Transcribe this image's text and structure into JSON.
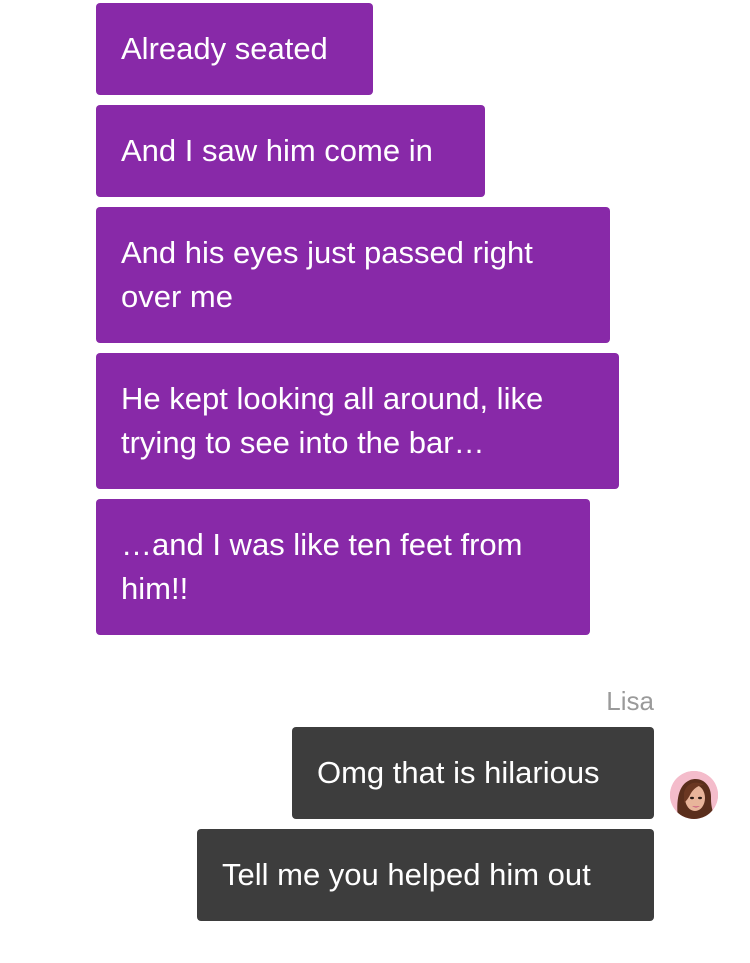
{
  "incoming_messages": [
    {
      "text": "Already seated"
    },
    {
      "text": "And I saw him come in"
    },
    {
      "text": "And his eyes just passed right over me"
    },
    {
      "text": "He kept looking all around, like trying to see into the bar…"
    },
    {
      "text": "…and I was like ten feet from him!!"
    }
  ],
  "outgoing_group": {
    "sender_name": "Lisa",
    "avatar_icon": "contact-avatar-icon",
    "messages": [
      {
        "text": "Omg that is hilarious"
      },
      {
        "text": "Tell me you helped him out"
      }
    ]
  },
  "colors": {
    "incoming_bubble": "#8829a8",
    "outgoing_bubble": "#3d3d3d",
    "sender_name": "#9a9a9a"
  }
}
